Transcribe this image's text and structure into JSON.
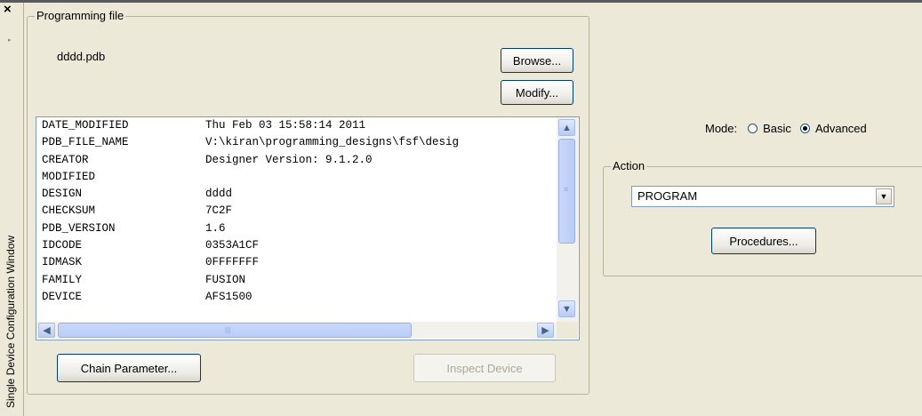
{
  "window": {
    "title": "Single Device Configuration Window",
    "close_glyph": "×",
    "pin_glyph": "▸"
  },
  "programming_file": {
    "group_label": "Programming file",
    "file_name": "dddd.pdb",
    "browse_label": "Browse...",
    "modify_label": "Modify...",
    "info_rows": [
      {
        "key": "DATE_MODIFIED",
        "value": "Thu Feb 03 15:58:14 2011"
      },
      {
        "key": "PDB_FILE_NAME",
        "value": "V:\\kiran\\programming_designs\\fsf\\desig"
      },
      {
        "key": "CREATOR",
        "value": "Designer Version: 9.1.2.0"
      },
      {
        "key": "MODIFIED",
        "value": ""
      },
      {
        "key": "DESIGN",
        "value": "dddd"
      },
      {
        "key": "CHECKSUM",
        "value": "7C2F"
      },
      {
        "key": "PDB_VERSION",
        "value": "1.6"
      },
      {
        "key": "IDCODE",
        "value": "0353A1CF"
      },
      {
        "key": "IDMASK",
        "value": "0FFFFFFF"
      },
      {
        "key": "FAMILY",
        "value": "FUSION"
      },
      {
        "key": "DEVICE",
        "value": "AFS1500"
      }
    ]
  },
  "buttons": {
    "chain_parameter": "Chain Parameter...",
    "inspect_device": "Inspect Device",
    "procedures": "Procedures..."
  },
  "mode": {
    "label": "Mode:",
    "options": [
      {
        "label": "Basic",
        "selected": false
      },
      {
        "label": "Advanced",
        "selected": true
      }
    ]
  },
  "action": {
    "group_label": "Action",
    "selected": "PROGRAM"
  },
  "icons": {
    "scroll_up": "▲",
    "scroll_down": "▼",
    "scroll_left": "◀",
    "scroll_right": "▶",
    "dropdown": "▼",
    "thumb_grip_v": "≡",
    "thumb_grip_h": "|||"
  },
  "colors": {
    "background": "#ece9d8",
    "button_border": "#003c74",
    "scrollbar_blue": "#b7cbf3"
  }
}
